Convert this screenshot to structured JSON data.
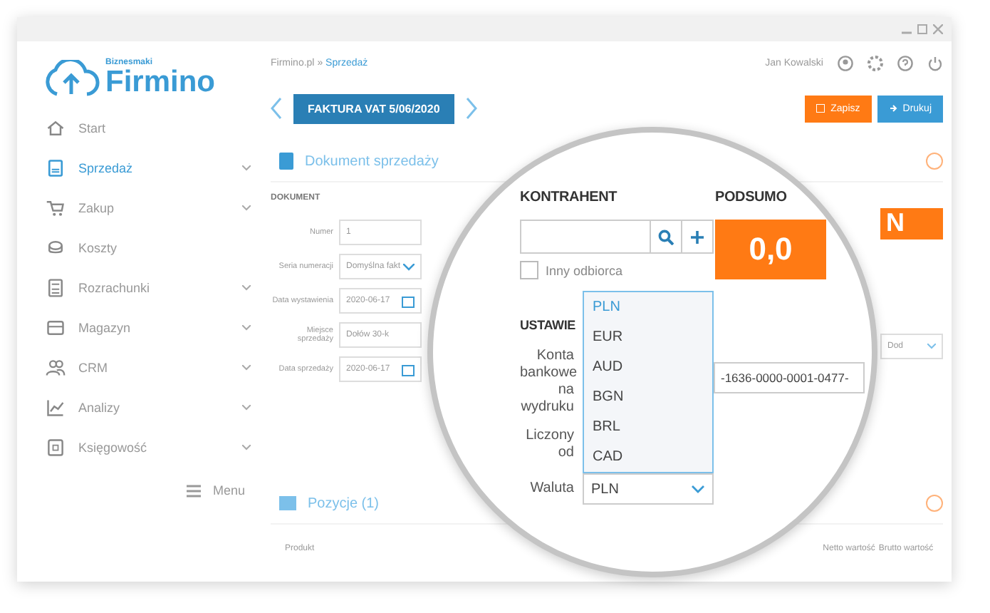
{
  "logo": {
    "tagline": "Biznesmaki",
    "name": "Firmino"
  },
  "sidebar": {
    "items": [
      {
        "label": "Start",
        "selected": false,
        "expandable": false
      },
      {
        "label": "Sprzedaż",
        "selected": true,
        "expandable": true
      },
      {
        "label": "Zakup",
        "selected": false,
        "expandable": true
      },
      {
        "label": "Koszty",
        "selected": false,
        "expandable": false
      },
      {
        "label": "Rozrachunki",
        "selected": false,
        "expandable": true
      },
      {
        "label": "Magazyn",
        "selected": false,
        "expandable": true
      },
      {
        "label": "CRM",
        "selected": false,
        "expandable": true
      },
      {
        "label": "Analizy",
        "selected": false,
        "expandable": true
      },
      {
        "label": "Księgowość",
        "selected": false,
        "expandable": true
      }
    ],
    "menu_button": "Menu"
  },
  "breadcrumb": {
    "root": "Firmino.pl",
    "separator": "»",
    "current": "Sprzedaż"
  },
  "user": {
    "name": "Jan Kowalski"
  },
  "document_title": "FAKTURA VAT 5/06/2020",
  "actions": [
    {
      "label": "Zapisz",
      "kind": "save"
    },
    {
      "label": "Drukuj",
      "kind": "print"
    }
  ],
  "section": {
    "title": "Dokument sprzedaży"
  },
  "document_form": {
    "heading": "DOKUMENT",
    "fields": [
      {
        "label": "Numer",
        "value": "1",
        "kind": "text"
      },
      {
        "label": "Seria numeracji",
        "value": "Domyślna fakt",
        "kind": "select"
      },
      {
        "label": "Data wystawienia",
        "value": "2020-06-17",
        "kind": "date"
      },
      {
        "label": "Miejsce sprzedaży",
        "value": "Dołów 30-k",
        "kind": "text"
      },
      {
        "label": "Data sprzedaży",
        "value": "2020-06-17",
        "kind": "date"
      }
    ]
  },
  "contractor": {
    "heading": "KONTRAHENT",
    "other_recipient": {
      "label": "Inny odbiorca",
      "checked": false
    }
  },
  "summary": {
    "heading": "PODSUMO",
    "amount": "0,0",
    "amount_tail": "N"
  },
  "settings": {
    "heading": "USTAWIE",
    "bank_label": "Konta bankowe na wydruku",
    "bank_value": "-1636-0000-0001-0477-",
    "bank_select": "Dod",
    "counted_label": "Liczony od",
    "currency_label": "Waluta",
    "currency_value": "PLN",
    "currency_options": [
      {
        "label": "PLN",
        "selected": true
      },
      {
        "label": "EUR",
        "selected": false
      },
      {
        "label": "AUD",
        "selected": false
      },
      {
        "label": "BGN",
        "selected": false
      },
      {
        "label": "BRL",
        "selected": false
      },
      {
        "label": "CAD",
        "selected": false
      }
    ]
  },
  "positions": {
    "title": "Pozycje (1)",
    "columns": [
      "Produkt",
      "Netto wartość",
      "Brutto wartość"
    ]
  }
}
